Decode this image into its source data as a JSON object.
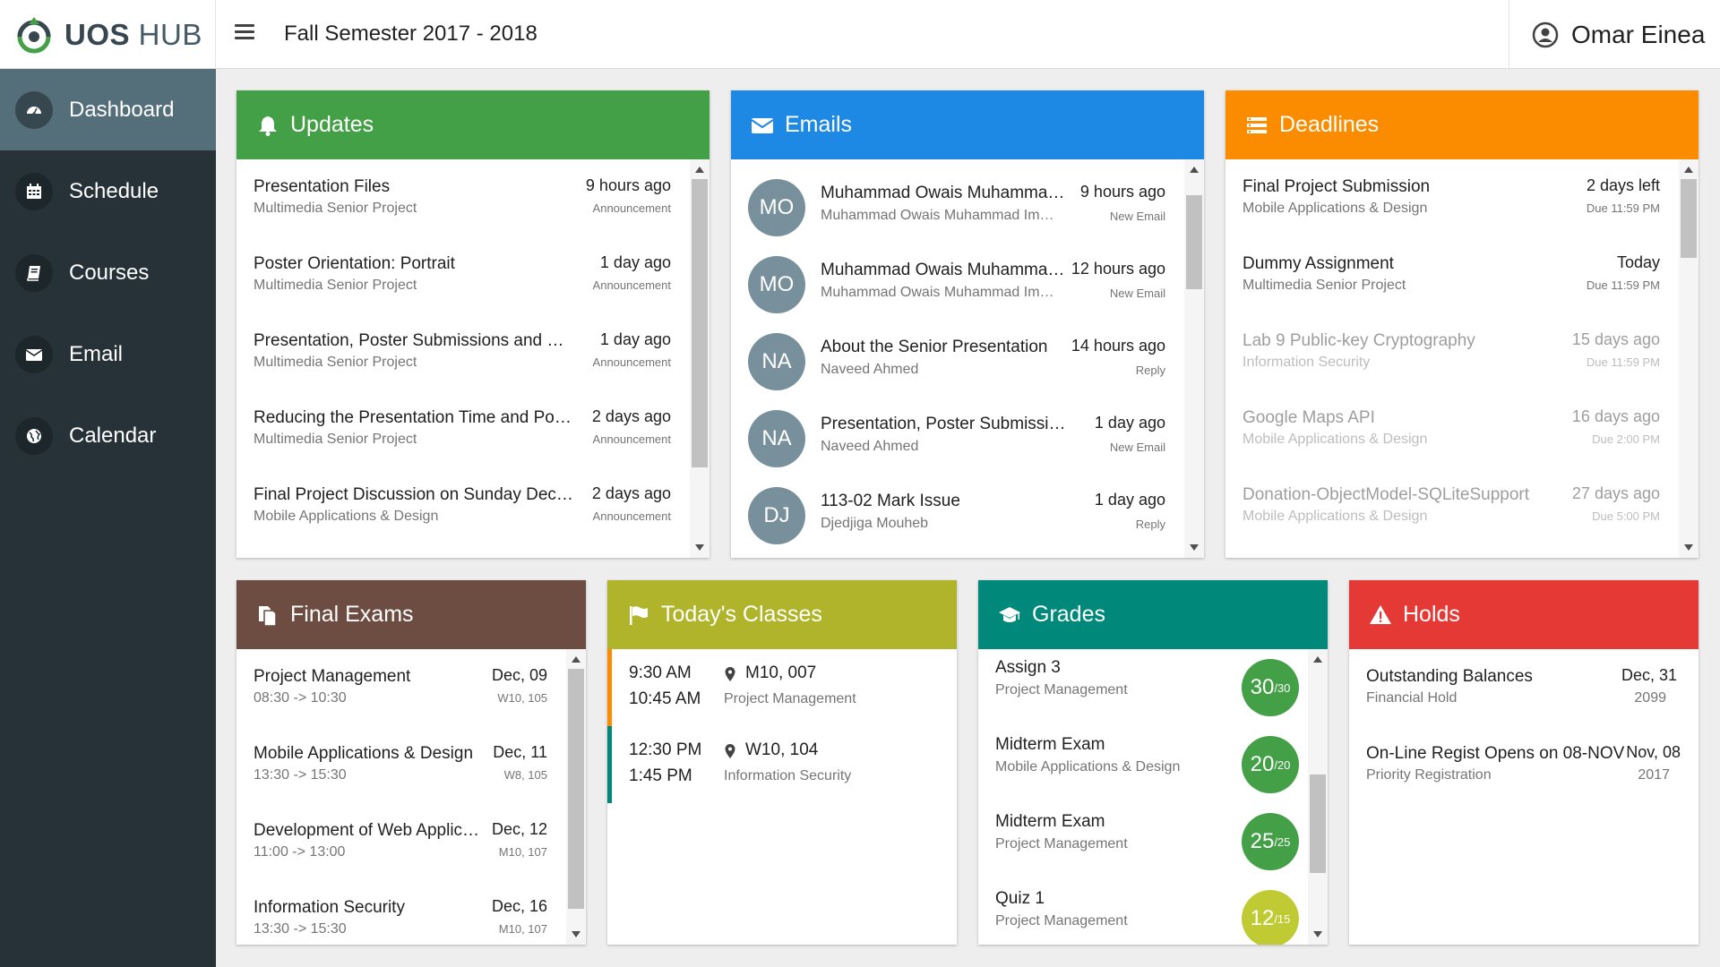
{
  "app": {
    "logo_bold": "UOS",
    "logo_light": " HUB",
    "semester": "Fall Semester 2017 - 2018",
    "user_name": "Omar Einea"
  },
  "nav": [
    {
      "label": "Dashboard",
      "icon": "dashboard-icon",
      "active": true
    },
    {
      "label": "Schedule",
      "icon": "calendar-grid-icon",
      "active": false
    },
    {
      "label": "Courses",
      "icon": "book-icon",
      "active": false
    },
    {
      "label": "Email",
      "icon": "envelope-icon",
      "active": false
    },
    {
      "label": "Calendar",
      "icon": "globe-icon",
      "active": false
    }
  ],
  "colors": {
    "updates": "#43a047",
    "emails": "#1e88e5",
    "deadlines": "#fb8c00",
    "final_exams": "#6d4c41",
    "todays_classes": "#afb42b",
    "grades": "#00897b",
    "holds": "#e53935",
    "sidebar": "#263238",
    "sidebar_active": "#546e7a"
  },
  "updates": {
    "title": "Updates",
    "items": [
      {
        "title": "Presentation Files",
        "course": "Multimedia Senior Project",
        "time": "9 hours ago",
        "type": "Announcement"
      },
      {
        "title": "Poster Orientation: Portrait",
        "course": "Multimedia Senior Project",
        "time": "1 day ago",
        "type": "Announcement"
      },
      {
        "title": "Presentation, Poster Submissions and …",
        "course": "Multimedia Senior Project",
        "time": "1 day ago",
        "type": "Announcement"
      },
      {
        "title": "Reducing the Presentation Time and Po…",
        "course": "Multimedia Senior Project",
        "time": "2 days ago",
        "type": "Announcement"
      },
      {
        "title": "Final Project Discussion on Sunday Dec…",
        "course": "Mobile Applications & Design",
        "time": "2 days ago",
        "type": "Announcement"
      }
    ]
  },
  "emails": {
    "title": "Emails",
    "items": [
      {
        "initials": "MO",
        "subject": "Muhammad Owais Muhamma…",
        "from": "Muhammad Owais Muhammad Im…",
        "time": "9 hours ago",
        "status": "New Email"
      },
      {
        "initials": "MO",
        "subject": "Muhammad Owais Muhamma…",
        "from": "Muhammad Owais Muhammad Im…",
        "time": "12 hours ago",
        "status": "New Email"
      },
      {
        "initials": "NA",
        "subject": "About the Senior Presentation",
        "from": "Naveed Ahmed",
        "time": "14 hours ago",
        "status": "Reply"
      },
      {
        "initials": "NA",
        "subject": "Presentation, Poster Submissi…",
        "from": "Naveed Ahmed",
        "time": "1 day ago",
        "status": "New Email"
      },
      {
        "initials": "DJ",
        "subject": "113-02 Mark Issue",
        "from": "Djedjiga Mouheb",
        "time": "1 day ago",
        "status": "Reply"
      }
    ]
  },
  "deadlines": {
    "title": "Deadlines",
    "items": [
      {
        "title": "Final Project Submission",
        "course": "Mobile Applications & Design",
        "when": "2 days left",
        "due": "Due 11:59 PM",
        "faded": false
      },
      {
        "title": "Dummy Assignment",
        "course": "Multimedia Senior Project",
        "when": "Today",
        "due": "Due 11:59 PM",
        "faded": false
      },
      {
        "title": "Lab 9 Public-key Cryptography",
        "course": "Information Security",
        "when": "15 days ago",
        "due": "Due 11:59 PM",
        "faded": true
      },
      {
        "title": "Google Maps API",
        "course": "Mobile Applications & Design",
        "when": "16 days ago",
        "due": "Due 2:00 PM",
        "faded": true
      },
      {
        "title": "Donation-ObjectModel-SQLiteSupport",
        "course": "Mobile Applications & Design",
        "when": "27 days ago",
        "due": "Due 5:00 PM",
        "faded": true
      }
    ]
  },
  "final_exams": {
    "title": "Final Exams",
    "items": [
      {
        "course": "Project Management",
        "time": "08:30 -> 10:30",
        "date": "Dec, 09",
        "room": "W10, 105"
      },
      {
        "course": "Mobile Applications & Design",
        "time": "13:30 -> 15:30",
        "date": "Dec, 11",
        "room": "W8, 105"
      },
      {
        "course": "Development of Web Applic…",
        "time": "11:00 -> 13:00",
        "date": "Dec, 12",
        "room": "M10, 107"
      },
      {
        "course": "Information Security",
        "time": "13:30 -> 15:30",
        "date": "Dec, 16",
        "room": "M10, 107"
      }
    ]
  },
  "todays_classes": {
    "title": "Today's Classes",
    "items": [
      {
        "start": "9:30 AM",
        "end": "10:45 AM",
        "room": "M10, 007",
        "course": "Project Management",
        "accent": "#fb8c00"
      },
      {
        "start": "12:30 PM",
        "end": "1:45 PM",
        "room": "W10, 104",
        "course": "Information Security",
        "accent": "#00897b"
      }
    ]
  },
  "grades": {
    "title": "Grades",
    "items": [
      {
        "title": "Assign 3",
        "course": "Project Management",
        "score": "30",
        "total": "/30",
        "color": "#43a047"
      },
      {
        "title": "Midterm Exam",
        "course": "Mobile Applications & Design",
        "score": "20",
        "total": "/20",
        "color": "#43a047"
      },
      {
        "title": "Midterm Exam",
        "course": "Project Management",
        "score": "25",
        "total": "/25",
        "color": "#43a047"
      },
      {
        "title": "Quiz 1",
        "course": "Project Management",
        "score": "12",
        "total": "/15",
        "color": "#c0ca33"
      }
    ]
  },
  "holds": {
    "title": "Holds",
    "items": [
      {
        "title": "Outstanding Balances",
        "type": "Financial Hold",
        "date": "Dec, 31",
        "year": "2099"
      },
      {
        "title": "On-Line Regist Opens on 08-NOV",
        "type": "Priority Registration",
        "date": "Nov, 08",
        "year": "2017"
      }
    ]
  }
}
